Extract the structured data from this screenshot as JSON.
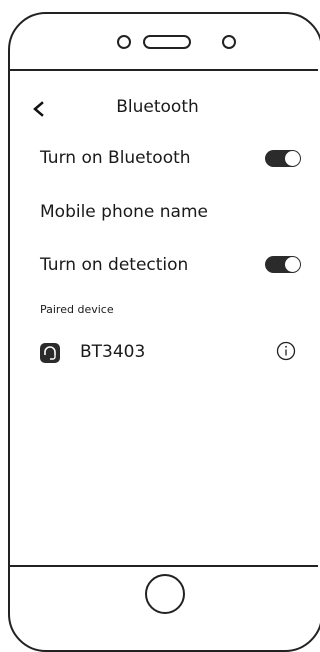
{
  "header": {
    "title": "Bluetooth",
    "back_icon": "chevron-left-icon"
  },
  "settings": {
    "bluetooth_label": "Turn on Bluetooth",
    "bluetooth_enabled": true,
    "phone_name_label": "Mobile phone name",
    "detection_label": "Turn on detection",
    "detection_enabled": true
  },
  "paired": {
    "section_label": "Paired device",
    "devices": [
      {
        "name": "BT3403",
        "icon": "headset-icon",
        "action_icon": "info-icon"
      }
    ]
  },
  "colors": {
    "toggle_on": "#2b2b2b",
    "outline": "#222222"
  }
}
